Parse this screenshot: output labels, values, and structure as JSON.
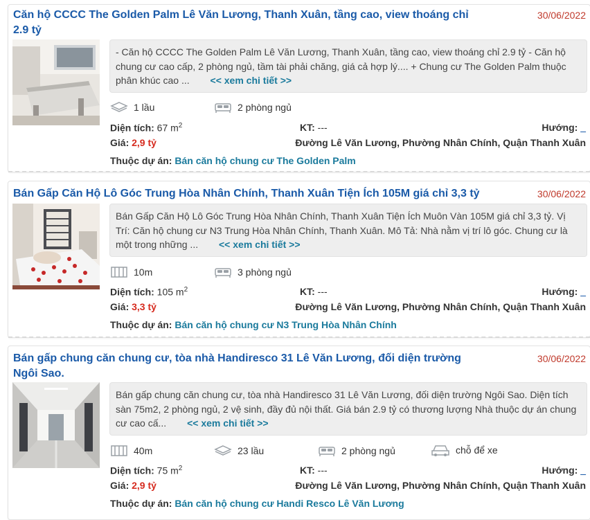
{
  "labels": {
    "area": "Diện tích:",
    "kt": "KT:",
    "direction": "Hướng:",
    "price": "Giá:",
    "project": "Thuộc dự án:",
    "more": "<< xem chi tiết >>"
  },
  "listings": [
    {
      "title": "Căn hộ CCCC The Golden Palm Lê Văn Lương, Thanh Xuân, tầng cao, view thoáng chỉ 2.9 tỷ",
      "date": "30/06/2022",
      "description": "- Căn hộ CCCC The Golden Palm Lê Văn Lương, Thanh Xuân, tầng cao, view thoáng chỉ 2.9 tỷ - Căn hộ chung cư cao cấp, 2 phòng ngủ, tầm tài phải chăng, giá cả hợp lý.... + Chung cư The Golden Palm thuộc phân khúc cao ...",
      "features": [
        {
          "icon": "floors-icon",
          "text": "1 lầu"
        },
        {
          "icon": "bed-icon",
          "text": "2 phòng ngủ"
        }
      ],
      "area_value": "67 m",
      "area_unit_sup": "2",
      "kt_value": "---",
      "direction_value": "_",
      "price_value": "2,9 tỷ",
      "address": "Đường Lê Văn Lương, Phường Nhân Chính, Quận Thanh Xuân",
      "project": "Bán căn hộ chung cư The Golden Palm"
    },
    {
      "title": "Bán Gấp Căn Hộ Lô Góc Trung Hòa Nhân Chính, Thanh Xuân Tiện Ích 105M giá chỉ 3,3 tỷ",
      "date": "30/06/2022",
      "description": "Bán Gấp Căn Hộ Lô Góc Trung Hòa Nhân Chính, Thanh Xuân Tiện Ích Muôn Vàn 105M giá chỉ 3,3 tỷ. Vị Trí: Căn hộ chung cư N3 Trung Hòa Nhân Chính, Thanh Xuân. Mô Tả: Nhà nằm vị trí lô góc. Chung cư là một trong những ...",
      "features": [
        {
          "icon": "frontage-icon",
          "text": "10m"
        },
        {
          "icon": "bed-icon",
          "text": "3 phòng ngủ"
        }
      ],
      "area_value": "105 m",
      "area_unit_sup": "2",
      "kt_value": "---",
      "direction_value": "_",
      "price_value": "3,3 tỷ",
      "address": "Đường Lê Văn Lương, Phường Nhân Chính, Quận Thanh Xuân",
      "project": "Bán căn hộ chung cư N3 Trung Hòa Nhân Chính"
    },
    {
      "title": "Bán gấp chung căn chung cư, tòa nhà Handiresco 31 Lê Văn Lương, đối diện trường Ngôi Sao.",
      "date": "30/06/2022",
      "description": "Bán gấp chung căn chung cư, tòa nhà Handiresco 31 Lê Văn Lương, đối diện trường Ngôi Sao. Diện tích sàn 75m2, 2 phòng ngủ, 2 vệ sinh, đầy đủ nội thất. Giá bán 2.9 tỷ có thương lượng Nhà thuộc dự án chung cư cao cấ...",
      "features": [
        {
          "icon": "frontage-icon",
          "text": "40m"
        },
        {
          "icon": "floors-icon",
          "text": "23 lầu"
        },
        {
          "icon": "bed-icon",
          "text": "2 phòng ngủ"
        },
        {
          "icon": "car-icon",
          "text": "chỗ để xe"
        }
      ],
      "area_value": "75 m",
      "area_unit_sup": "2",
      "kt_value": "---",
      "direction_value": "_",
      "price_value": "2,9 tỷ",
      "address": "Đường Lê Văn Lương, Phường Nhân Chính, Quận Thanh Xuân",
      "project": "Bán căn hộ chung cư Handi Resco Lê Văn Lương"
    }
  ]
}
